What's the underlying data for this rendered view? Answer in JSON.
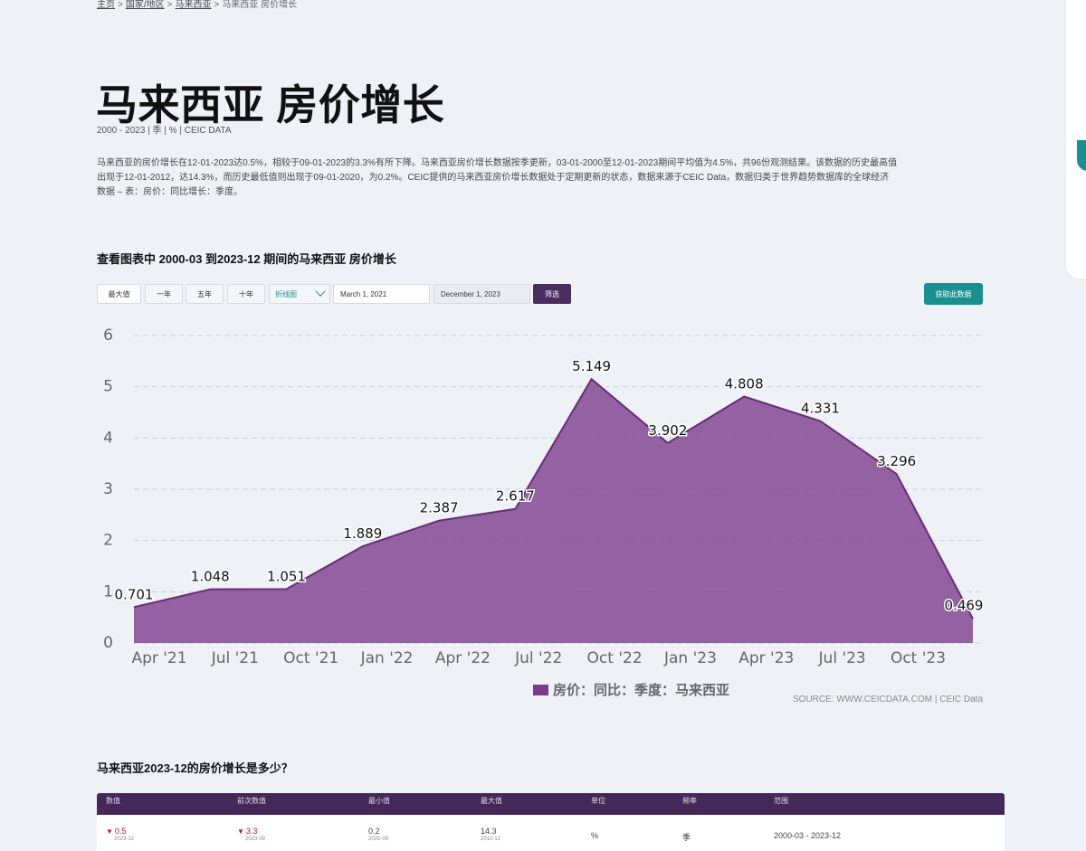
{
  "breadcrumb": {
    "home": "主页",
    "countries": "国家/地区",
    "country": "马来西亚",
    "current": "马来西亚 房价增长"
  },
  "page": {
    "title": "马来西亚 房价增长",
    "meta": "2000 - 2023 | 季 | % | CEIC DATA",
    "description": "马来西亚的房价增长在12-01-2023达0.5%，相较于09-01-2023的3.3%有所下降。马来西亚房价增长数据按季更新，03-01-2000至12-01-2023期间平均值为4.5%，共96份观测结果。该数据的历史最高值出现于12-01-2012，达14.3%，而历史最低值则出现于09-01-2020，为0.2%。CEIC提供的马来西亚房价增长数据处于定期更新的状态，数据来源于CEIC Data，数据归类于世界趋势数据库的全球经济数据 – 表：房价：同比增长：季度。"
  },
  "chart_section": {
    "title": "查看图表中 2000-03 到2023-12 期间的马来西亚 房价增长",
    "controls": {
      "max": "最大值",
      "one_year": "一年",
      "five_year": "五年",
      "ten_year": "十年",
      "chart_type": "折线图",
      "start_date": "March 1, 2021",
      "end_date": "December 1, 2023",
      "filter": "筛选",
      "get_data": "获取此数据"
    },
    "source": "SOURCE: WWW.CEICDATA.COM | CEIC Data"
  },
  "chart_data": {
    "type": "area",
    "x": [
      "2021-03",
      "2021-06",
      "2021-09",
      "2021-12",
      "2022-03",
      "2022-06",
      "2022-09",
      "2022-12",
      "2023-03",
      "2023-06",
      "2023-09",
      "2023-12"
    ],
    "series": [
      {
        "name": "房价：同比：季度：马来西亚",
        "values": [
          0.701,
          1.048,
          1.051,
          1.889,
          2.387,
          2.617,
          5.149,
          3.902,
          4.808,
          4.331,
          3.296,
          0.469
        ],
        "color": "#7b3a8a"
      }
    ],
    "x_tick_labels": [
      "Apr '21",
      "Jul '21",
      "Oct '21",
      "Jan '22",
      "Apr '22",
      "Jul '22",
      "Oct '22",
      "Jan '23",
      "Apr '23",
      "Jul '23",
      "Oct '23"
    ],
    "y_ticks": [
      0,
      1,
      2,
      3,
      4,
      5,
      6
    ],
    "ylim": [
      0,
      6
    ],
    "grid": true,
    "legend": "bottom"
  },
  "question": {
    "title": "马来西亚2023-12的房价增长是多少？"
  },
  "table": {
    "headers": [
      "数值",
      "前次数值",
      "最小值",
      "最大值",
      "单位",
      "频率",
      "范围"
    ],
    "row": {
      "value": "0.5",
      "value_date": "2023-12",
      "prev": "3.3",
      "prev_date": "2023-09",
      "min": "0.2",
      "min_date": "2020-09",
      "max": "14.3",
      "max_date": "2012-12",
      "unit": "%",
      "freq": "季",
      "range": "2000-03 - 2023-12"
    }
  }
}
